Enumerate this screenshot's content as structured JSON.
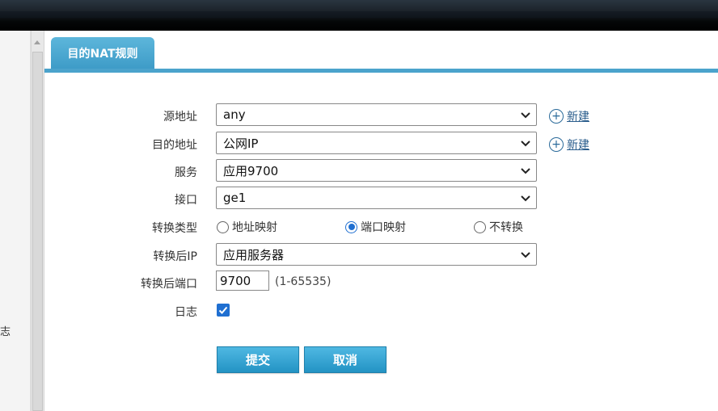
{
  "tab": {
    "title": "目的NAT规则"
  },
  "form": {
    "source_address": {
      "label": "源地址",
      "value": "any",
      "new_link": "新建"
    },
    "dest_address": {
      "label": "目的地址",
      "value": "公网IP",
      "new_link": "新建"
    },
    "service": {
      "label": "服务",
      "value": "应用9700"
    },
    "interface": {
      "label": "接口",
      "value": "ge1"
    },
    "translation_type": {
      "label": "转换类型",
      "options": [
        "地址映射",
        "端口映射",
        "不转换"
      ],
      "selected": "端口映射"
    },
    "translated_ip": {
      "label": "转换后IP",
      "value": "应用服务器"
    },
    "translated_port": {
      "label": "转换后端口",
      "value": "9700",
      "hint": "(1-65535)"
    },
    "log": {
      "label": "日志",
      "checked": true
    }
  },
  "buttons": {
    "submit": "提交",
    "cancel": "取消"
  },
  "left_panel": {
    "fragment": "志"
  },
  "colors": {
    "accent": "#3d9bc7",
    "link": "#2a5d8c",
    "checkbox": "#1f6fd1"
  }
}
